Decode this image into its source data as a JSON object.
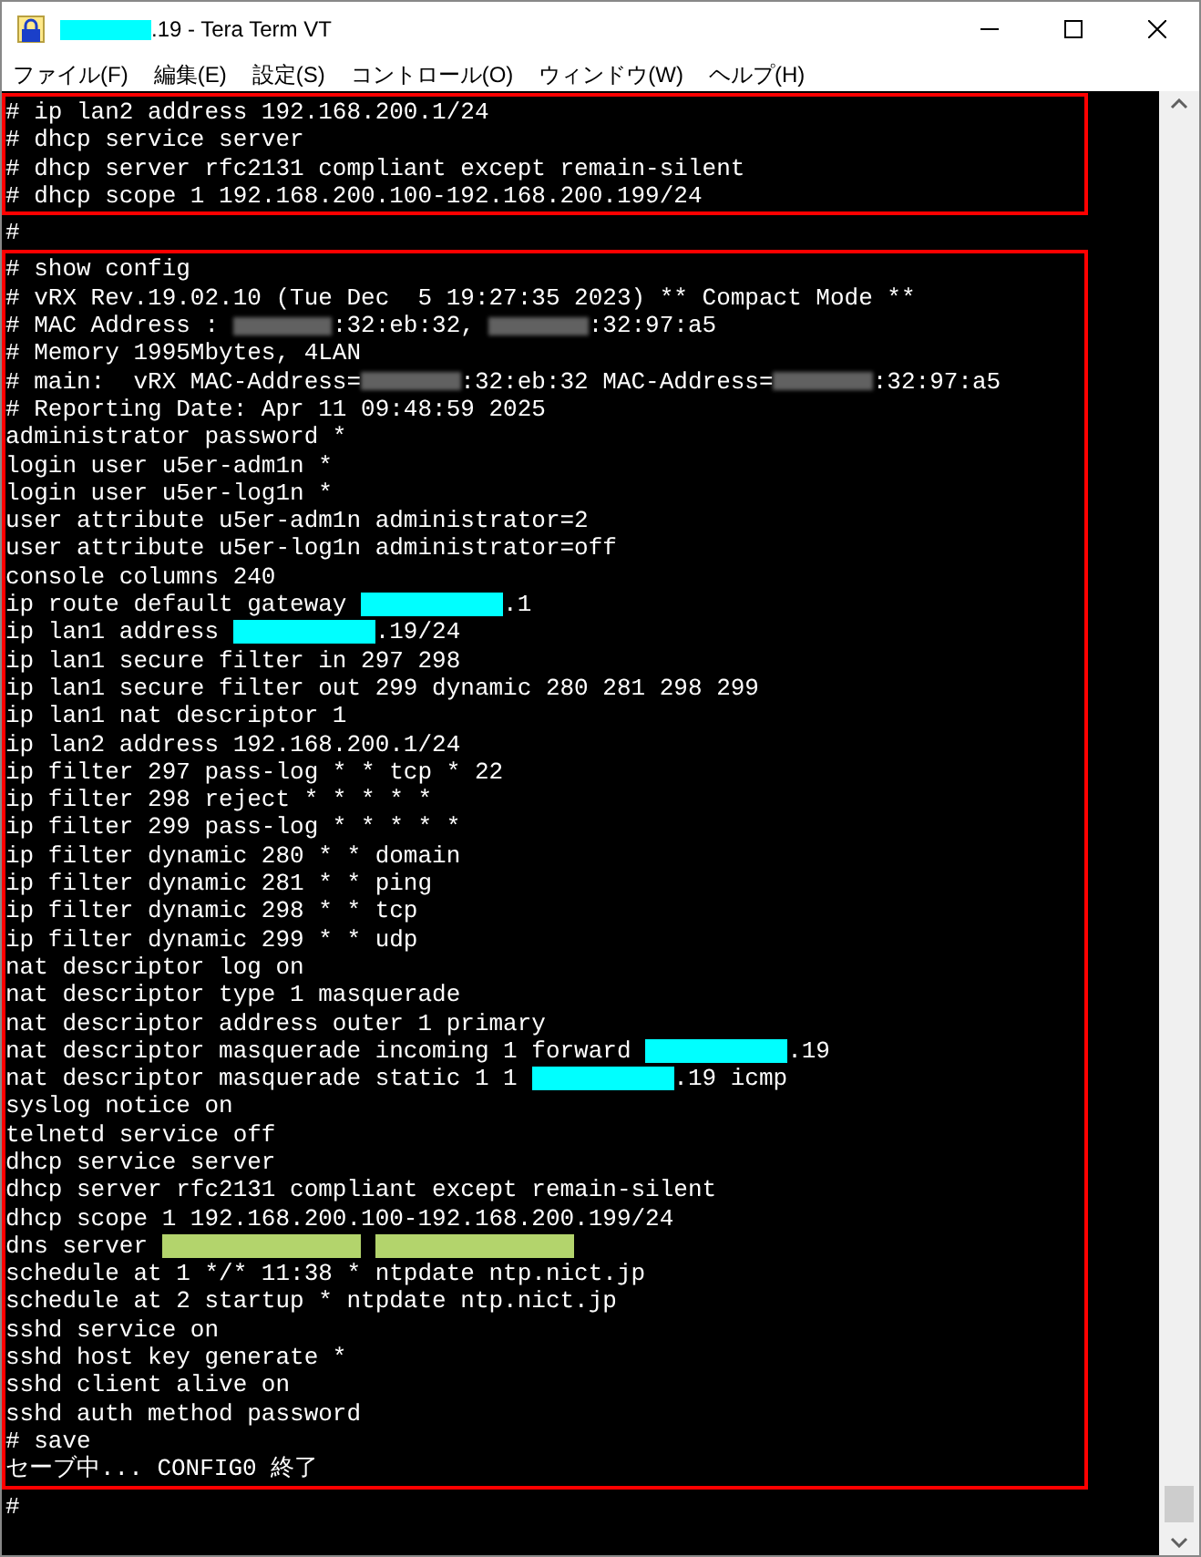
{
  "window": {
    "title": {
      "color": "#00ffff",
      "text": ".19 - Tera Term VT"
    }
  },
  "menu": [
    "ファイル(F)",
    "編集(E)",
    "設定(S)",
    "コントロール(O)",
    "ウィンドウ(W)",
    "ヘルプ(H)"
  ],
  "terminal": {
    "blocks": [
      {
        "highlighted": true,
        "lines": [
          "# ip lan2 address 192.168.200.1/24",
          "# dhcp service server",
          "# dhcp server rfc2131 compliant except remain-silent",
          "# dhcp scope 1 192.168.200.100-192.168.200.199/24"
        ]
      },
      {
        "highlighted": false,
        "lines": [
          "#"
        ]
      },
      {
        "highlighted": true,
        "lines": [
          "# show config",
          "# vRX Rev.19.02.10 (Tue Dec  5 19:27:35 2023) ** Compact Mode **",
          [
            {
              "kind": "text",
              "text": "# MAC Address : "
            },
            {
              "kind": "blur"
            },
            {
              "kind": "text",
              "text": ":32:eb:32, "
            },
            {
              "kind": "blur"
            },
            {
              "kind": "text",
              "text": ":32:97:a5"
            }
          ],
          "# Memory 1995Mbytes, 4LAN",
          [
            {
              "kind": "text",
              "text": "# main:  vRX MAC-Address="
            },
            {
              "kind": "blur"
            },
            {
              "kind": "text",
              "text": ":32:eb:32 MAC-Address="
            },
            {
              "kind": "blur"
            },
            {
              "kind": "text",
              "text": ":32:97:a5"
            }
          ],
          "# Reporting Date: Apr 11 09:48:59 2025",
          "administrator password *",
          "login user u5er-adm1n *",
          "login user u5er-log1n *",
          "user attribute u5er-adm1n administrator=2",
          "user attribute u5er-log1n administrator=off",
          "console columns 240",
          [
            {
              "kind": "text",
              "text": "ip route default gateway "
            },
            {
              "kind": "redaction",
              "color": "#00ffff"
            },
            {
              "kind": "text",
              "text": ".1"
            }
          ],
          [
            {
              "kind": "text",
              "text": "ip lan1 address "
            },
            {
              "kind": "redaction",
              "color": "#00ffff"
            },
            {
              "kind": "text",
              "text": ".19/24"
            }
          ],
          "ip lan1 secure filter in 297 298",
          "ip lan1 secure filter out 299 dynamic 280 281 298 299",
          "ip lan1 nat descriptor 1",
          "ip lan2 address 192.168.200.1/24",
          "ip filter 297 pass-log * * tcp * 22",
          "ip filter 298 reject * * * * *",
          "ip filter 299 pass-log * * * * *",
          "ip filter dynamic 280 * * domain",
          "ip filter dynamic 281 * * ping",
          "ip filter dynamic 298 * * tcp",
          "ip filter dynamic 299 * * udp",
          "nat descriptor log on",
          "nat descriptor type 1 masquerade",
          "nat descriptor address outer 1 primary",
          [
            {
              "kind": "text",
              "text": "nat descriptor masquerade incoming 1 forward "
            },
            {
              "kind": "redaction",
              "color": "#00ffff"
            },
            {
              "kind": "text",
              "text": ".19"
            }
          ],
          [
            {
              "kind": "text",
              "text": "nat descriptor masquerade static 1 1 "
            },
            {
              "kind": "redaction",
              "color": "#00ffff"
            },
            {
              "kind": "text",
              "text": ".19 icmp"
            }
          ],
          "syslog notice on",
          "telnetd service off",
          "dhcp service server",
          "dhcp server rfc2131 compliant except remain-silent",
          "dhcp scope 1 192.168.200.100-192.168.200.199/24",
          [
            {
              "kind": "text",
              "text": "dns server "
            },
            {
              "kind": "wide_redaction",
              "color": "#b3d46c"
            },
            {
              "kind": "wide_redaction",
              "color": "#b3d46c"
            }
          ],
          "schedule at 1 */* 11:38 * ntpdate ntp.nict.jp",
          "schedule at 2 startup * ntpdate ntp.nict.jp",
          "sshd service on",
          "sshd host key generate *",
          "sshd client alive on",
          "sshd auth method password",
          "# save",
          "セーブ中... CONFIG0 終了"
        ]
      },
      {
        "highlighted": false,
        "lines": [
          "#"
        ]
      }
    ]
  }
}
